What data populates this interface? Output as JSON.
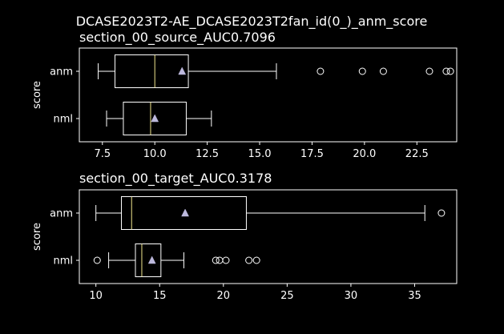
{
  "figure": {
    "suptitle": "DCASE2023T2-AE_DCASE2023T2fan_id(0_)_anm_score",
    "background": "#000000",
    "foreground": "#ffffff",
    "median_color": "#f0e68c",
    "mean_marker_color": "#bcb8dc"
  },
  "chart_data": [
    {
      "type": "boxplot",
      "orientation": "horizontal",
      "title": "section_00_source_AUC0.7096",
      "ylabel": "score",
      "xlabel": "",
      "xlim": [
        6.4,
        24.4
      ],
      "xticks": [
        7.5,
        10.0,
        12.5,
        15.0,
        17.5,
        20.0,
        22.5
      ],
      "xtick_labels": [
        "7.5",
        "10.0",
        "12.5",
        "15.0",
        "17.5",
        "20.0",
        "22.5"
      ],
      "grid": false,
      "categories": [
        "anm",
        "nml"
      ],
      "boxes": [
        {
          "label": "anm",
          "whislo": 7.3,
          "q1": 8.1,
          "med": 10.0,
          "q3": 11.6,
          "whishi": 15.8,
          "mean": 11.3,
          "fliers": [
            17.9,
            19.9,
            20.9,
            23.1,
            23.9,
            24.1
          ]
        },
        {
          "label": "nml",
          "whislo": 7.7,
          "q1": 8.5,
          "med": 9.8,
          "q3": 11.5,
          "whishi": 12.7,
          "mean": 10.0,
          "fliers": []
        }
      ]
    },
    {
      "type": "boxplot",
      "orientation": "horizontal",
      "title": "section_00_target_AUC0.3178",
      "ylabel": "score",
      "xlabel": "",
      "xlim": [
        8.7,
        38.3
      ],
      "xticks": [
        10,
        15,
        20,
        25,
        30,
        35
      ],
      "xtick_labels": [
        "10",
        "15",
        "20",
        "25",
        "30",
        "35"
      ],
      "grid": false,
      "categories": [
        "anm",
        "nml"
      ],
      "boxes": [
        {
          "label": "anm",
          "whislo": 10.0,
          "q1": 12.0,
          "med": 12.8,
          "q3": 21.8,
          "whishi": 35.8,
          "mean": 17.0,
          "fliers": [
            37.1
          ]
        },
        {
          "label": "nml",
          "whislo": 11.0,
          "q1": 13.1,
          "med": 13.6,
          "q3": 15.1,
          "whishi": 16.9,
          "mean": 14.4,
          "fliers": [
            10.1,
            19.4,
            19.7,
            20.2,
            22.0,
            22.6
          ]
        }
      ]
    }
  ]
}
